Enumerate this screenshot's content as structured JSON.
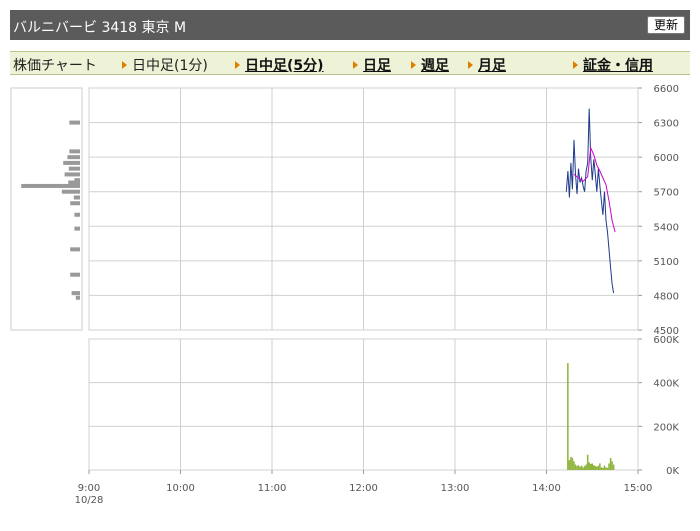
{
  "header": {
    "title": "バルニバービ 3418 東京 M",
    "refresh_label": "更新"
  },
  "tabs": {
    "static_label": "株価チャート",
    "items": [
      {
        "label": "日中足(1分)"
      },
      {
        "label": "日中足(5分)"
      },
      {
        "label": "日足"
      },
      {
        "label": "週足"
      },
      {
        "label": "月足"
      },
      {
        "label": "証金・信用"
      }
    ]
  },
  "colors": {
    "price_line": "#1e3a8a",
    "moving_average": "#cc00cc",
    "volume_bars": "#8db33a",
    "price_distribution_bars": "#999999",
    "grid": "#d0d0d0"
  },
  "chart_data": [
    {
      "type": "line",
      "x_ticks": [
        "9:00",
        "10:00",
        "11:00",
        "12:00",
        "13:00",
        "14:00",
        "15:00"
      ],
      "x_sub_label": "10/28",
      "ylim": [
        4500,
        6600
      ],
      "y_ticks": [
        "6600",
        "6300",
        "6000",
        "5700",
        "5400",
        "5100",
        "4800",
        "4500"
      ],
      "series": [
        {
          "role": "price",
          "points": [
            [
              "14:13",
              5700
            ],
            [
              "14:14",
              5880
            ],
            [
              "14:15",
              5650
            ],
            [
              "14:16",
              5950
            ],
            [
              "14:17",
              5720
            ],
            [
              "14:18",
              6150
            ],
            [
              "14:19",
              5850
            ],
            [
              "14:20",
              5680
            ],
            [
              "14:21",
              5900
            ],
            [
              "14:22",
              5780
            ],
            [
              "14:23",
              5820
            ],
            [
              "14:24",
              5750
            ],
            [
              "14:25",
              5700
            ],
            [
              "14:26",
              5880
            ],
            [
              "14:27",
              5950
            ],
            [
              "14:28",
              6420
            ],
            [
              "14:29",
              6000
            ],
            [
              "14:30",
              5800
            ],
            [
              "14:31",
              5980
            ],
            [
              "14:32",
              5850
            ],
            [
              "14:33",
              5700
            ],
            [
              "14:34",
              5900
            ],
            [
              "14:35",
              5750
            ],
            [
              "14:36",
              5620
            ],
            [
              "14:37",
              5500
            ],
            [
              "14:38",
              5700
            ],
            [
              "14:39",
              5450
            ],
            [
              "14:40",
              5350
            ],
            [
              "14:41",
              5200
            ],
            [
              "14:42",
              5050
            ],
            [
              "14:43",
              4900
            ],
            [
              "14:44",
              4820
            ]
          ]
        },
        {
          "role": "moving-average",
          "points": [
            [
              "14:18",
              5850
            ],
            [
              "14:21",
              5820
            ],
            [
              "14:24",
              5790
            ],
            [
              "14:27",
              5830
            ],
            [
              "14:29",
              6080
            ],
            [
              "14:31",
              6020
            ],
            [
              "14:33",
              5930
            ],
            [
              "14:35",
              5880
            ],
            [
              "14:37",
              5820
            ],
            [
              "14:39",
              5760
            ],
            [
              "14:41",
              5620
            ],
            [
              "14:43",
              5450
            ],
            [
              "14:45",
              5350
            ]
          ]
        }
      ],
      "price_distribution": [
        [
          6300,
          0.38
        ],
        [
          6050,
          0.38
        ],
        [
          6000,
          0.45
        ],
        [
          5950,
          0.6
        ],
        [
          5900,
          0.4
        ],
        [
          5850,
          0.55
        ],
        [
          5800,
          0.2
        ],
        [
          5780,
          0.42
        ],
        [
          5750,
          2.1
        ],
        [
          5700,
          0.65
        ],
        [
          5650,
          0.22
        ],
        [
          5600,
          0.35
        ],
        [
          5500,
          0.2
        ],
        [
          5380,
          0.2
        ],
        [
          5200,
          0.35
        ],
        [
          4980,
          0.35
        ],
        [
          4820,
          0.3
        ],
        [
          4780,
          0.15
        ]
      ]
    },
    {
      "type": "bar",
      "role": "volume",
      "ylim": [
        0,
        600000
      ],
      "y_ticks": [
        "600K",
        "400K",
        "200K",
        "0K"
      ],
      "bars": [
        [
          "14:14",
          490000
        ],
        [
          "14:15",
          45000
        ],
        [
          "14:16",
          60000
        ],
        [
          "14:17",
          55000
        ],
        [
          "14:18",
          40000
        ],
        [
          "14:19",
          25000
        ],
        [
          "14:20",
          18000
        ],
        [
          "14:21",
          22000
        ],
        [
          "14:22",
          15000
        ],
        [
          "14:23",
          20000
        ],
        [
          "14:24",
          12000
        ],
        [
          "14:25",
          18000
        ],
        [
          "14:26",
          25000
        ],
        [
          "14:27",
          70000
        ],
        [
          "14:28",
          35000
        ],
        [
          "14:29",
          28000
        ],
        [
          "14:30",
          30000
        ],
        [
          "14:31",
          22000
        ],
        [
          "14:32",
          18000
        ],
        [
          "14:33",
          15000
        ],
        [
          "14:34",
          20000
        ],
        [
          "14:35",
          30000
        ],
        [
          "14:36",
          12000
        ],
        [
          "14:37",
          10000
        ],
        [
          "14:38",
          20000
        ],
        [
          "14:39",
          12000
        ],
        [
          "14:40",
          10000
        ],
        [
          "14:41",
          30000
        ],
        [
          "14:42",
          55000
        ],
        [
          "14:43",
          40000
        ],
        [
          "14:44",
          25000
        ]
      ]
    }
  ]
}
